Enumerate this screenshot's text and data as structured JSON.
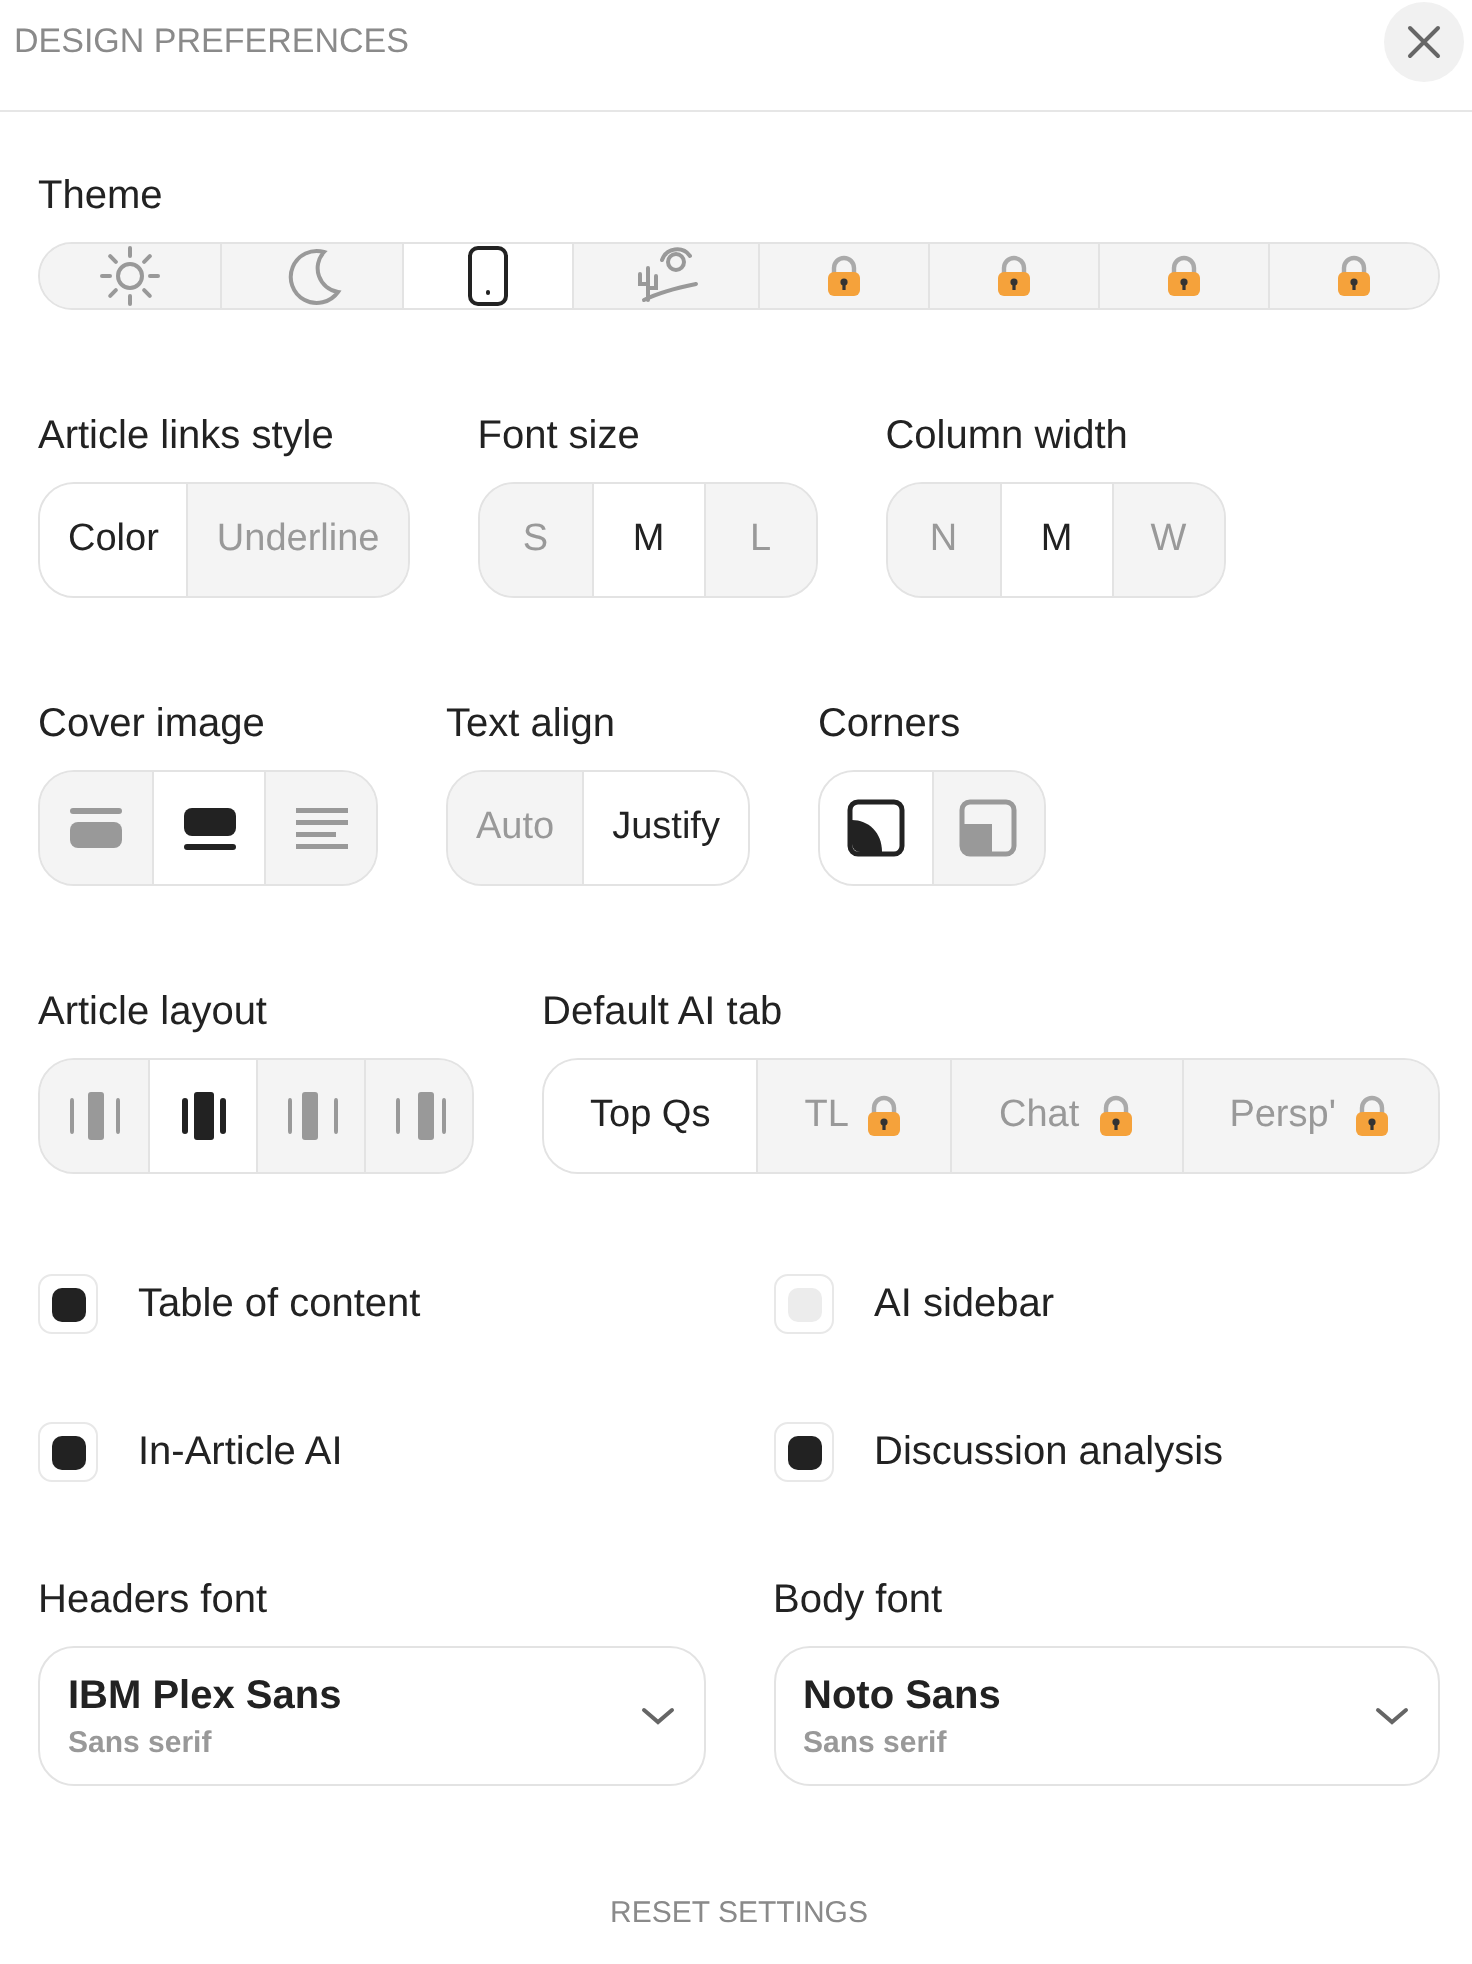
{
  "header": {
    "title": "DESIGN PREFERENCES"
  },
  "rows": [
    {
      "groups": [
        {
          "kind": "theme",
          "label": "Theme",
          "options": [
            {
              "selected": false,
              "locked": false
            },
            {
              "selected": false,
              "locked": false
            },
            {
              "selected": true,
              "locked": false
            },
            {
              "selected": false,
              "locked": false
            },
            {
              "selected": false,
              "locked": true
            },
            {
              "selected": false,
              "locked": true
            },
            {
              "selected": false,
              "locked": true
            },
            {
              "selected": false,
              "locked": true
            }
          ]
        }
      ]
    },
    {
      "groups": [
        {
          "kind": "text",
          "label": "Article links style",
          "options": [
            {
              "label": "Color",
              "selected": true
            },
            {
              "label": "Underline",
              "selected": false
            }
          ]
        },
        {
          "kind": "text",
          "label": "Font size",
          "options": [
            {
              "label": "S",
              "selected": false
            },
            {
              "label": "M",
              "selected": true
            },
            {
              "label": "L",
              "selected": false
            }
          ]
        },
        {
          "kind": "text",
          "label": "Column width",
          "options": [
            {
              "label": "N",
              "selected": false
            },
            {
              "label": "M",
              "selected": true
            },
            {
              "label": "W",
              "selected": false
            }
          ]
        }
      ]
    },
    {
      "groups": [
        {
          "kind": "cover",
          "label": "Cover image",
          "options": [
            {
              "selected": false
            },
            {
              "selected": true
            },
            {
              "selected": false
            }
          ]
        },
        {
          "kind": "text",
          "label": "Text align",
          "options": [
            {
              "label": "Auto",
              "selected": false
            },
            {
              "label": "Justify",
              "selected": true
            }
          ]
        },
        {
          "kind": "corners",
          "label": "Corners",
          "options": [
            {
              "selected": true
            },
            {
              "selected": false
            }
          ]
        }
      ]
    },
    {
      "groups": [
        {
          "kind": "layout",
          "label": "Article layout",
          "options": [
            {
              "selected": false
            },
            {
              "selected": true
            },
            {
              "selected": false
            },
            {
              "selected": false
            }
          ]
        },
        {
          "kind": "text",
          "label": "Default AI tab",
          "options": [
            {
              "label": "Top Qs",
              "selected": true,
              "locked": false
            },
            {
              "label": "TL",
              "selected": false,
              "locked": true
            },
            {
              "label": "Chat",
              "selected": false,
              "locked": true
            },
            {
              "label": "Persp'",
              "selected": false,
              "locked": true
            }
          ]
        }
      ]
    }
  ],
  "toggles": [
    {
      "label": "Table of content",
      "checked": true
    },
    {
      "label": "AI sidebar",
      "checked": false
    },
    {
      "label": "In-Article AI",
      "checked": true
    },
    {
      "label": "Discussion analysis",
      "checked": true
    }
  ],
  "fonts": [
    {
      "label": "Headers font",
      "value": "IBM Plex Sans",
      "category": "Sans serif"
    },
    {
      "label": "Body font",
      "value": "Noto Sans",
      "category": "Sans serif"
    }
  ],
  "reset": "RESET SETTINGS"
}
